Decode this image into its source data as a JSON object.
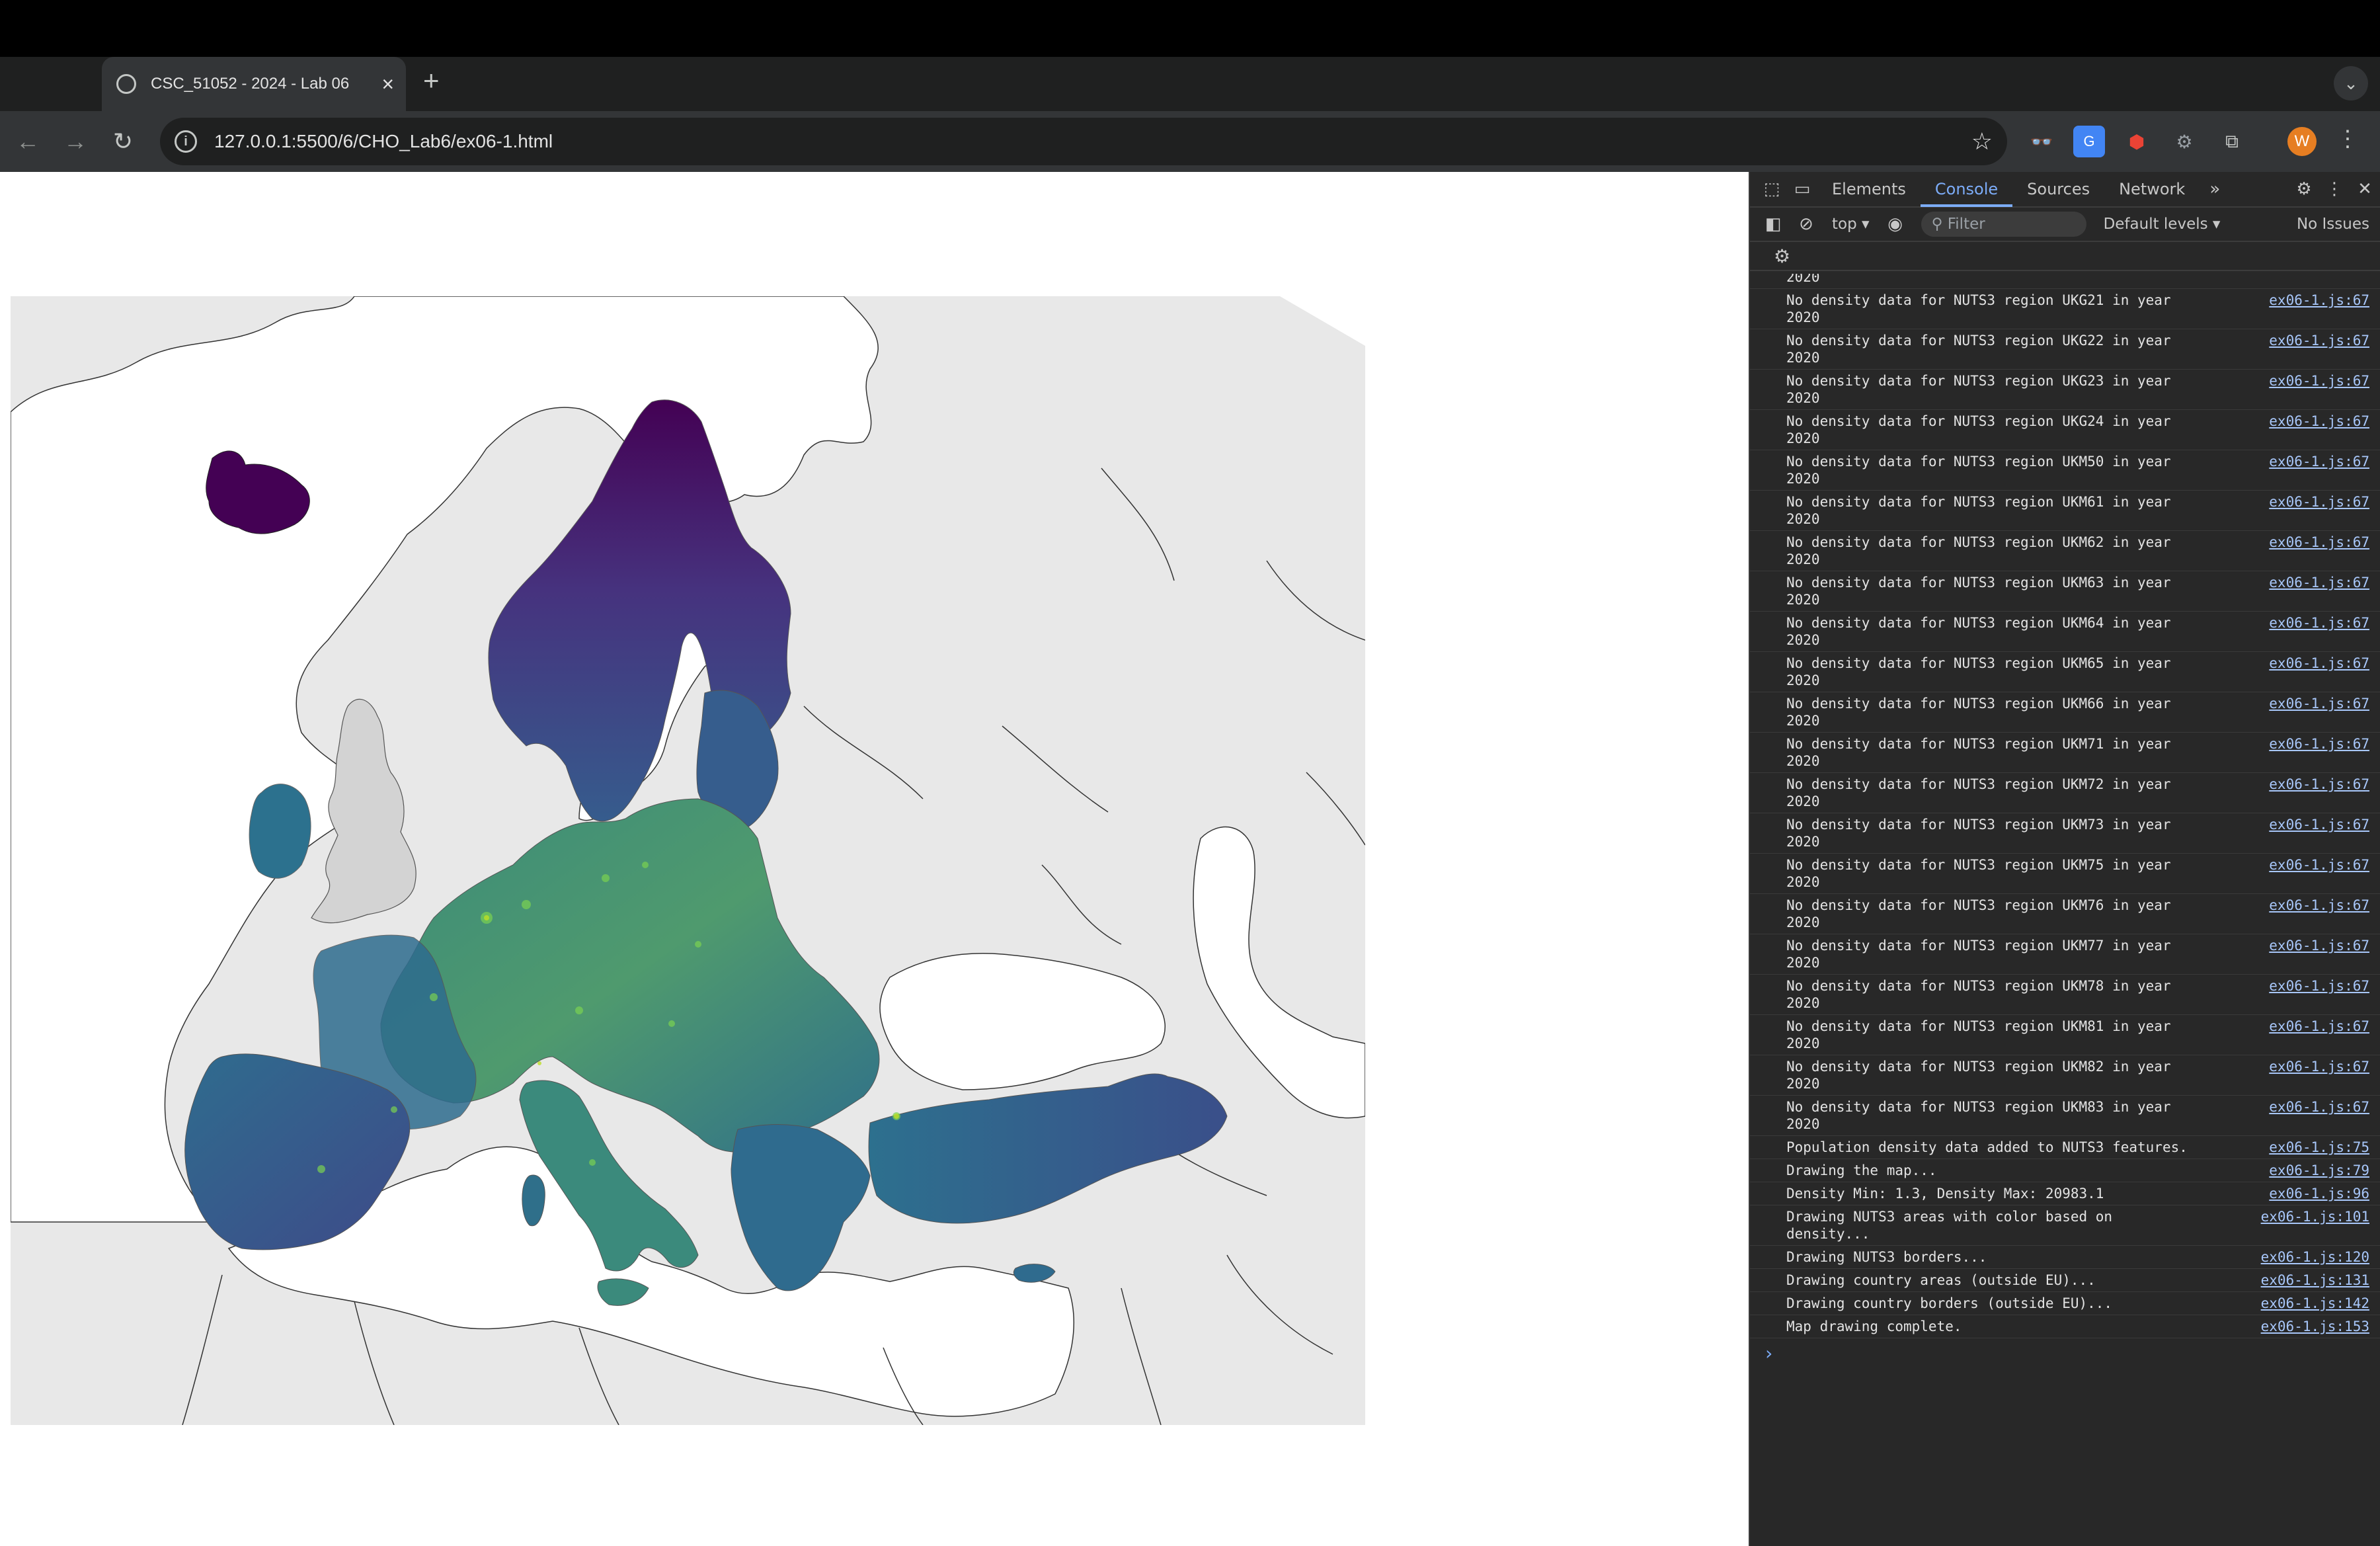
{
  "browser": {
    "tab_title": "CSC_51052 - 2024 - Lab 06",
    "url": "127.0.0.1:5500/6/CHO_Lab6/ex06-1.html",
    "new_tab_label": "+",
    "profile_initial": "W"
  },
  "devtools": {
    "tabs": [
      "Elements",
      "Console",
      "Sources",
      "Network"
    ],
    "active_tab": "Console",
    "more_tabs_label": "»",
    "context": "top",
    "filter_placeholder": "Filter",
    "levels": "Default levels",
    "issues": "No Issues",
    "partial_first_line": "2020",
    "console": [
      {
        "text": "No density data for NUTS3 region UKG21 in year\n2020",
        "src": "ex06-1.js:67"
      },
      {
        "text": "No density data for NUTS3 region UKG22 in year\n2020",
        "src": "ex06-1.js:67"
      },
      {
        "text": "No density data for NUTS3 region UKG23 in year\n2020",
        "src": "ex06-1.js:67"
      },
      {
        "text": "No density data for NUTS3 region UKG24 in year\n2020",
        "src": "ex06-1.js:67"
      },
      {
        "text": "No density data for NUTS3 region UKM50 in year\n2020",
        "src": "ex06-1.js:67"
      },
      {
        "text": "No density data for NUTS3 region UKM61 in year\n2020",
        "src": "ex06-1.js:67"
      },
      {
        "text": "No density data for NUTS3 region UKM62 in year\n2020",
        "src": "ex06-1.js:67"
      },
      {
        "text": "No density data for NUTS3 region UKM63 in year\n2020",
        "src": "ex06-1.js:67"
      },
      {
        "text": "No density data for NUTS3 region UKM64 in year\n2020",
        "src": "ex06-1.js:67"
      },
      {
        "text": "No density data for NUTS3 region UKM65 in year\n2020",
        "src": "ex06-1.js:67"
      },
      {
        "text": "No density data for NUTS3 region UKM66 in year\n2020",
        "src": "ex06-1.js:67"
      },
      {
        "text": "No density data for NUTS3 region UKM71 in year\n2020",
        "src": "ex06-1.js:67"
      },
      {
        "text": "No density data for NUTS3 region UKM72 in year\n2020",
        "src": "ex06-1.js:67"
      },
      {
        "text": "No density data for NUTS3 region UKM73 in year\n2020",
        "src": "ex06-1.js:67"
      },
      {
        "text": "No density data for NUTS3 region UKM75 in year\n2020",
        "src": "ex06-1.js:67"
      },
      {
        "text": "No density data for NUTS3 region UKM76 in year\n2020",
        "src": "ex06-1.js:67"
      },
      {
        "text": "No density data for NUTS3 region UKM77 in year\n2020",
        "src": "ex06-1.js:67"
      },
      {
        "text": "No density data for NUTS3 region UKM78 in year\n2020",
        "src": "ex06-1.js:67"
      },
      {
        "text": "No density data for NUTS3 region UKM81 in year\n2020",
        "src": "ex06-1.js:67"
      },
      {
        "text": "No density data for NUTS3 region UKM82 in year\n2020",
        "src": "ex06-1.js:67"
      },
      {
        "text": "No density data for NUTS3 region UKM83 in year\n2020",
        "src": "ex06-1.js:67"
      },
      {
        "text": "Population density data added to NUTS3 features.",
        "src": "ex06-1.js:75"
      },
      {
        "text": "Drawing the map...",
        "src": "ex06-1.js:79"
      },
      {
        "text": "Density Min: 1.3, Density Max: 20983.1",
        "src": "ex06-1.js:96"
      },
      {
        "text": "Drawing NUTS3 areas with color based on\ndensity...",
        "src": "ex06-1.js:101"
      },
      {
        "text": "Drawing NUTS3 borders...",
        "src": "ex06-1.js:120"
      },
      {
        "text": "Drawing country areas (outside EU)...",
        "src": "ex06-1.js:131"
      },
      {
        "text": "Drawing country borders (outside EU)...",
        "src": "ex06-1.js:142"
      },
      {
        "text": "Map drawing complete.",
        "src": "ex06-1.js:153"
      }
    ],
    "prompt": "›"
  },
  "map": {
    "colors": {
      "background_land": "#e8e8e8",
      "sea": "#ffffff",
      "no_data": "#d3d3d3",
      "viridis_low": "#440154",
      "viridis_mid": "#3b528b",
      "viridis_teal": "#21908d",
      "viridis_green": "#5dc963",
      "viridis_high": "#fde725"
    }
  }
}
